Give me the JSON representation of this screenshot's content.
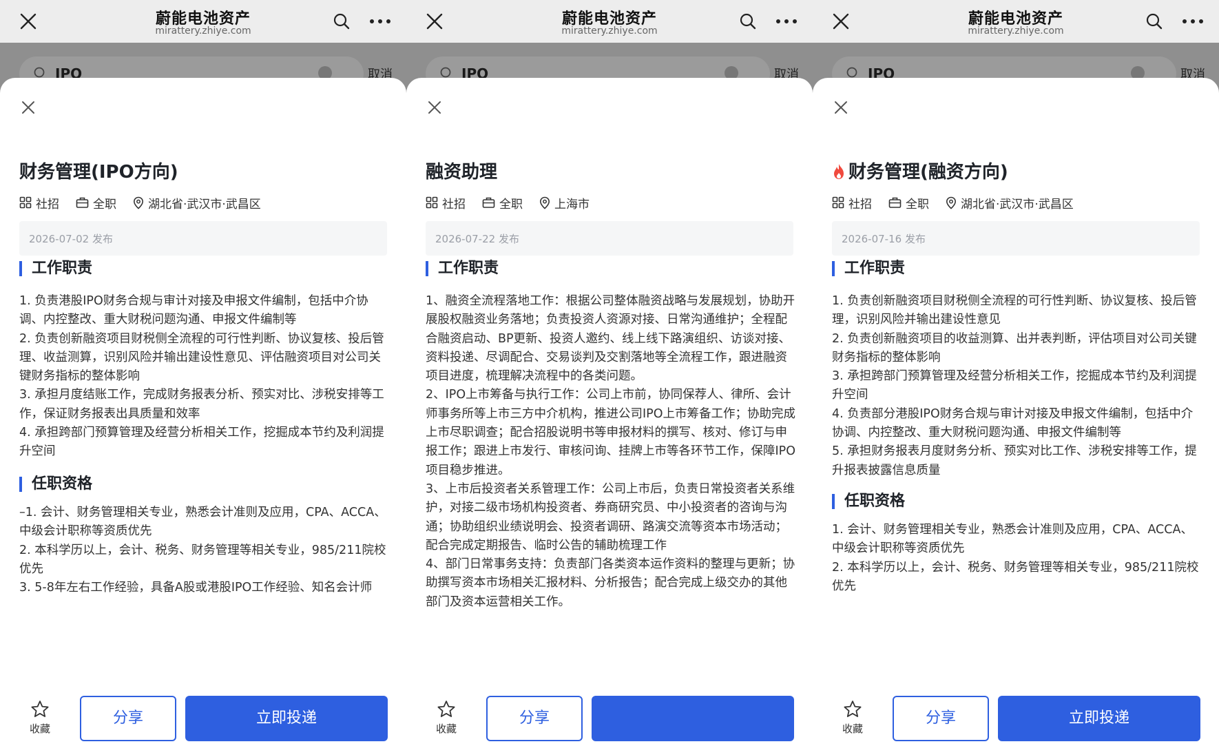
{
  "app": {
    "title": "蔚能电池资产",
    "url": "mirattery.zhiye.com"
  },
  "search": {
    "query": "IPO",
    "cancel": "取消"
  },
  "icons": {
    "close": "close-icon",
    "search": "search-icon",
    "more": "more-icon",
    "star": "star-icon",
    "location": "location-pin-icon",
    "grid": "grid-icon",
    "briefcase": "briefcase-icon",
    "hot": "fire-icon"
  },
  "colors": {
    "accent": "#2e5fe0",
    "hot": "#f04a3e"
  },
  "actions": {
    "favorite": "收藏",
    "share": "分享",
    "apply": "立即投递"
  },
  "panels": [
    {
      "title": "财务管理(IPO方向)",
      "hot": false,
      "tags": {
        "recruit_type": "社招",
        "job_type": "全职",
        "location": "湖北省·武汉市·武昌区"
      },
      "date": "2026-07-02 发布",
      "duties_title": "工作职责",
      "duties": [
        "1. 负责港股IPO财务合规与审计对接及申报文件编制，包括中介协调、内控整改、重大财税问题沟通、申报文件编制等",
        "2. 负责创新融资项目财税侧全流程的可行性判断、协议复核、投后管理、收益测算，识别风险并输出建设性意见、评估融资项目对公司关键财务指标的整体影响",
        "3. 承担月度结账工作，完成财务报表分析、预实对比、涉税安排等工作，保证财务报表出具质量和效率",
        "4. 承担跨部门预算管理及经营分析相关工作，挖掘成本节约及利润提升空间"
      ],
      "req_title": "任职资格",
      "reqs": [
        "–1. 会计、财务管理相关专业，熟悉会计准则及应用，CPA、ACCA、中级会计职称等资质优先",
        "2. 本科学历以上，会计、税务、财务管理等相关专业，985/211院校优先",
        "3. 5-8年左右工作经验，具备A股或港股IPO工作经验、知名会计师"
      ],
      "apply_label": "立即投递"
    },
    {
      "title": "融资助理",
      "hot": false,
      "tags": {
        "recruit_type": "社招",
        "job_type": "全职",
        "location": "上海市"
      },
      "date": "2026-07-22 发布",
      "duties_title": "工作职责",
      "duties": [
        "1、融资全流程落地工作：根据公司整体融资战略与发展规划，协助开展股权融资业务落地；负责投资人资源对接、日常沟通维护；全程配合融资启动、BP更新、投资人邀约、线上线下路演组织、访谈对接、资料投递、尽调配合、交易谈判及交割落地等全流程工作，跟进融资项目进度，梳理解决流程中的各类问题。",
        "2、IPO上市筹备与执行工作：公司上市前，协同保荐人、律所、会计师事务所等上市三方中介机构，推进公司IPO上市筹备工作；协助完成上市尽职调查；配合招股说明书等申报材料的撰写、核对、修订与申报工作；跟进上市发行、审核问询、挂牌上市等各环节工作，保障IPO项目稳步推进。",
        "3、上市后投资者关系管理工作：公司上市后，负责日常投资者关系维护，对接二级市场机构投资者、券商研究员、中小投资者的咨询与沟通；协助组织业绩说明会、投资者调研、路演交流等资本市场活动；配合完成定期报告、临时公告的辅助梳理工作",
        "4、部门日常事务支持：负责部门各类资本运作资料的整理与更新；协助撰写资本市场相关汇报材料、分析报告；配合完成上级交办的其他部门及资本运营相关工作。"
      ],
      "req_title": "",
      "reqs": [],
      "apply_label": ""
    },
    {
      "title": "财务管理(融资方向)",
      "hot": true,
      "tags": {
        "recruit_type": "社招",
        "job_type": "全职",
        "location": "湖北省·武汉市·武昌区"
      },
      "date": "2026-07-16 发布",
      "duties_title": "工作职责",
      "duties": [
        "1. 负责创新融资项目财税侧全流程的可行性判断、协议复核、投后管理，识别风险并输出建设性意见",
        "2. 负责创新融资项目的收益测算、出并表判断，评估项目对公司关键财务指标的整体影响",
        "3. 承担跨部门预算管理及经营分析相关工作，挖掘成本节约及利润提升空间",
        "4. 负责部分港股IPO财务合规与审计对接及申报文件编制，包括中介协调、内控整改、重大财税问题沟通、申报文件编制等",
        "5. 承担财务报表月度财务分析、预实对比工作、涉税安排等工作，提升报表披露信息质量"
      ],
      "req_title": "任职资格",
      "reqs": [
        "1. 会计、财务管理相关专业，熟悉会计准则及应用，CPA、ACCA、中级会计职称等资质优先",
        "2. 本科学历以上，会计、税务、财务管理等相关专业，985/211院校优先"
      ],
      "apply_label": "立即投递"
    }
  ]
}
